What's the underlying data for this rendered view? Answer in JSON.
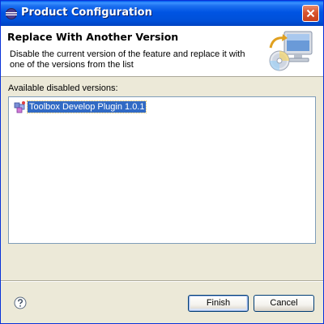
{
  "window": {
    "title": "Product Configuration",
    "title_icon": "eclipse-icon",
    "close_icon": "close-icon",
    "titlebar_color": "#0054e3"
  },
  "header": {
    "title": "Replace With Another Version",
    "description": "Disable the current version of the feature and replace it with one of the versions from the list",
    "graphic_icon": "computer-cd-update-icon"
  },
  "versions": {
    "label": "Available disabled versions:",
    "items": [
      {
        "label": "Toolbox Develop Plugin 1.0.1",
        "icon": "feature-plugin-icon",
        "selected": true
      }
    ],
    "selection_color": "#316ac5"
  },
  "footer": {
    "help_icon": "help-icon",
    "finish_label": "Finish",
    "cancel_label": "Cancel"
  }
}
